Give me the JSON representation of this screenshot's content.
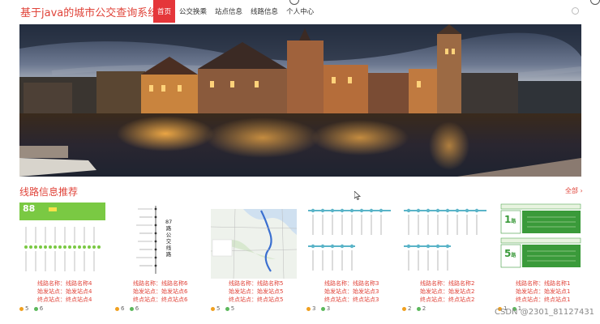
{
  "header": {
    "site_title": "基于java的城市公交查询系统",
    "nav": [
      "首页",
      "公交换乘",
      "站点信息",
      "线路信息",
      "个人中心"
    ]
  },
  "section": {
    "title": "线路信息推荐",
    "more": "全部",
    "more_arrow": "›"
  },
  "cards": [
    {
      "line1": "线路名称：线路名称4",
      "line2": "始发站点：始发站点4",
      "line3": "终点站点：终点站点4",
      "likes": "5",
      "favs": "6"
    },
    {
      "line1": "线路名称：线路名称6",
      "line2": "始发站点：始发站点6",
      "line3": "终点站点：终点站点6",
      "likes": "6",
      "favs": "6"
    },
    {
      "line1": "线路名称：线路名称5",
      "line2": "始发站点：始发站点5",
      "line3": "终点站点：终点站点5",
      "likes": "5",
      "favs": "5"
    },
    {
      "line1": "线路名称：线路名称3",
      "line2": "始发站点：始发站点3",
      "line3": "终点站点：终点站点3",
      "likes": "3",
      "favs": "3"
    },
    {
      "line1": "线路名称：线路名称2",
      "line2": "始发站点：始发站点2",
      "line3": "终点站点：终点站点2",
      "likes": "2",
      "favs": "2"
    },
    {
      "line1": "线路名称：线路名称1",
      "line2": "始发站点：始发站点1",
      "line3": "终点站点：终点站点1",
      "likes": "1",
      "favs": "1"
    }
  ],
  "thumb_text": {
    "card1_number": "88",
    "card2_vertical": [
      "87",
      "路",
      "公",
      "交",
      "线",
      "路"
    ],
    "card6_numbers": [
      "1",
      "5"
    ],
    "card6_unit": "路"
  },
  "watermark": "CSDN @2301_81127431",
  "colors": {
    "accent": "#e0443a",
    "nav_active": "#e5363a",
    "route_green": "#3a9a3a"
  }
}
